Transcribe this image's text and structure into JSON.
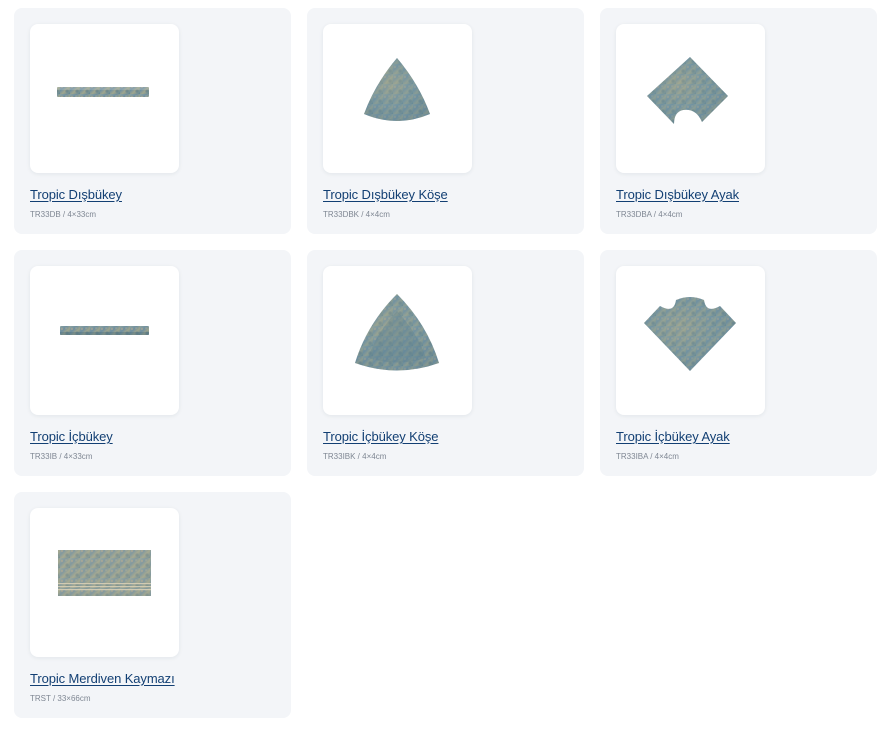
{
  "colors": {
    "card_bg": "#f3f5f8",
    "link": "#123f73",
    "meta": "#7f8793",
    "tile_blue": "#6f8fa0",
    "tile_sand": "#b6a88d"
  },
  "products": [
    {
      "title": "Tropic Dışbükey",
      "code": "TR33DB",
      "size": "4×33cm",
      "meta": "TR33DB / 4×33cm",
      "icon": "convex-bar-icon"
    },
    {
      "title": "Tropic Dışbükey Köşe",
      "code": "TR33DBK",
      "size": "4×4cm",
      "meta": "TR33DBK / 4×4cm",
      "icon": "convex-corner-icon"
    },
    {
      "title": "Tropic Dışbükey Ayak",
      "code": "TR33DBA",
      "size": "4×4cm",
      "meta": "TR33DBA / 4×4cm",
      "icon": "convex-foot-icon"
    },
    {
      "title": "Tropic İçbükey",
      "code": "TR33IB",
      "size": "4×33cm",
      "meta": "TR33IB / 4×33cm",
      "icon": "concave-bar-icon"
    },
    {
      "title": "Tropic İçbükey Köşe",
      "code": "TR33IBK",
      "size": "4×4cm",
      "meta": "TR33IBK / 4×4cm",
      "icon": "concave-corner-icon"
    },
    {
      "title": "Tropic İçbükey Ayak",
      "code": "TR33IBA",
      "size": "4×4cm",
      "meta": "TR33IBA / 4×4cm",
      "icon": "concave-foot-icon"
    },
    {
      "title": "Tropic Merdiven Kaymazı",
      "code": "TRST",
      "size": "33×66cm",
      "meta": "TRST / 33×66cm",
      "icon": "stair-nosing-icon"
    }
  ]
}
